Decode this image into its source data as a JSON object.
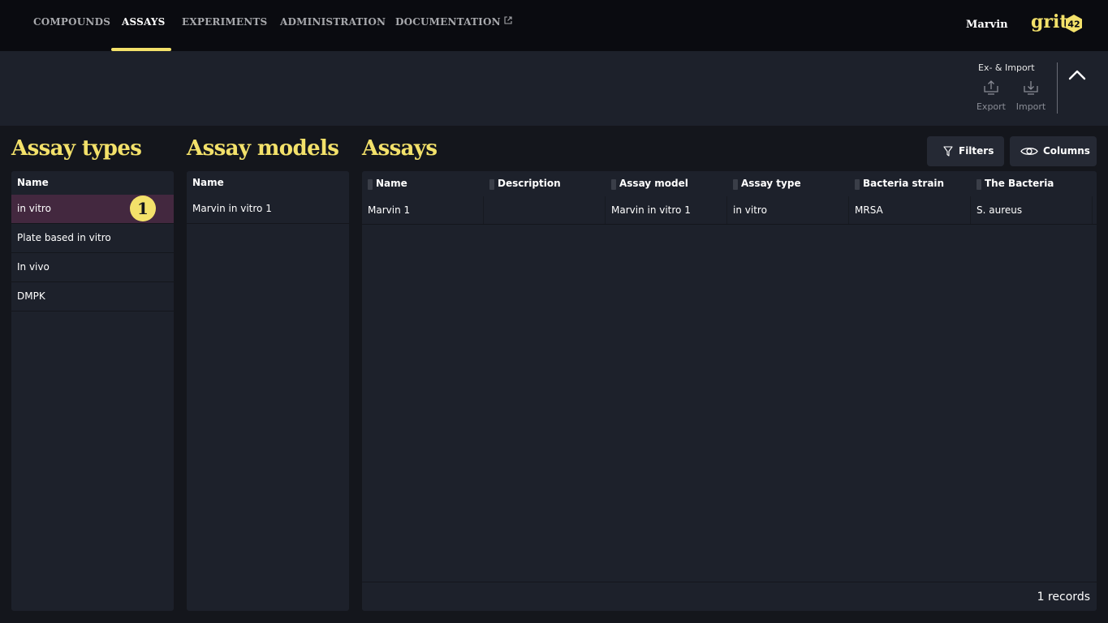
{
  "nav": {
    "items": [
      {
        "label": "COMPOUNDS"
      },
      {
        "label": "ASSAYS"
      },
      {
        "label": "EXPERIMENTS"
      },
      {
        "label": "ADMINISTRATION"
      },
      {
        "label": "DOCUMENTATION"
      }
    ],
    "active": "ASSAYS",
    "user": "Marvin",
    "logo_text": "grit",
    "logo_badge": "42"
  },
  "toolbar": {
    "group_label": "Ex- & Import",
    "export_label": "Export",
    "import_label": "Import"
  },
  "assay_types": {
    "title": "Assay types",
    "column": "Name",
    "rows": [
      "in vitro",
      "Plate based in vitro",
      "In vivo",
      "DMPK"
    ],
    "selected_index": 0,
    "badge": "1"
  },
  "assay_models": {
    "title": "Assay models",
    "column": "Name",
    "rows": [
      "Marvin in vitro 1"
    ]
  },
  "assays": {
    "title": "Assays",
    "filters_label": "Filters",
    "columns_label": "Columns",
    "columns": [
      "Name",
      "Description",
      "Assay model",
      "Assay type",
      "Bacteria strain",
      "The Bacteria"
    ],
    "rows": [
      [
        "Marvin 1",
        "",
        "Marvin in vitro 1",
        "in vitro",
        "MRSA",
        "S. aureus"
      ]
    ],
    "footer": "1 records"
  },
  "colors": {
    "accent": "#f3e16a",
    "selected_row": "#43283f",
    "panel": "#1d212b",
    "background": "#14161c",
    "nav": "#0a0b10"
  }
}
